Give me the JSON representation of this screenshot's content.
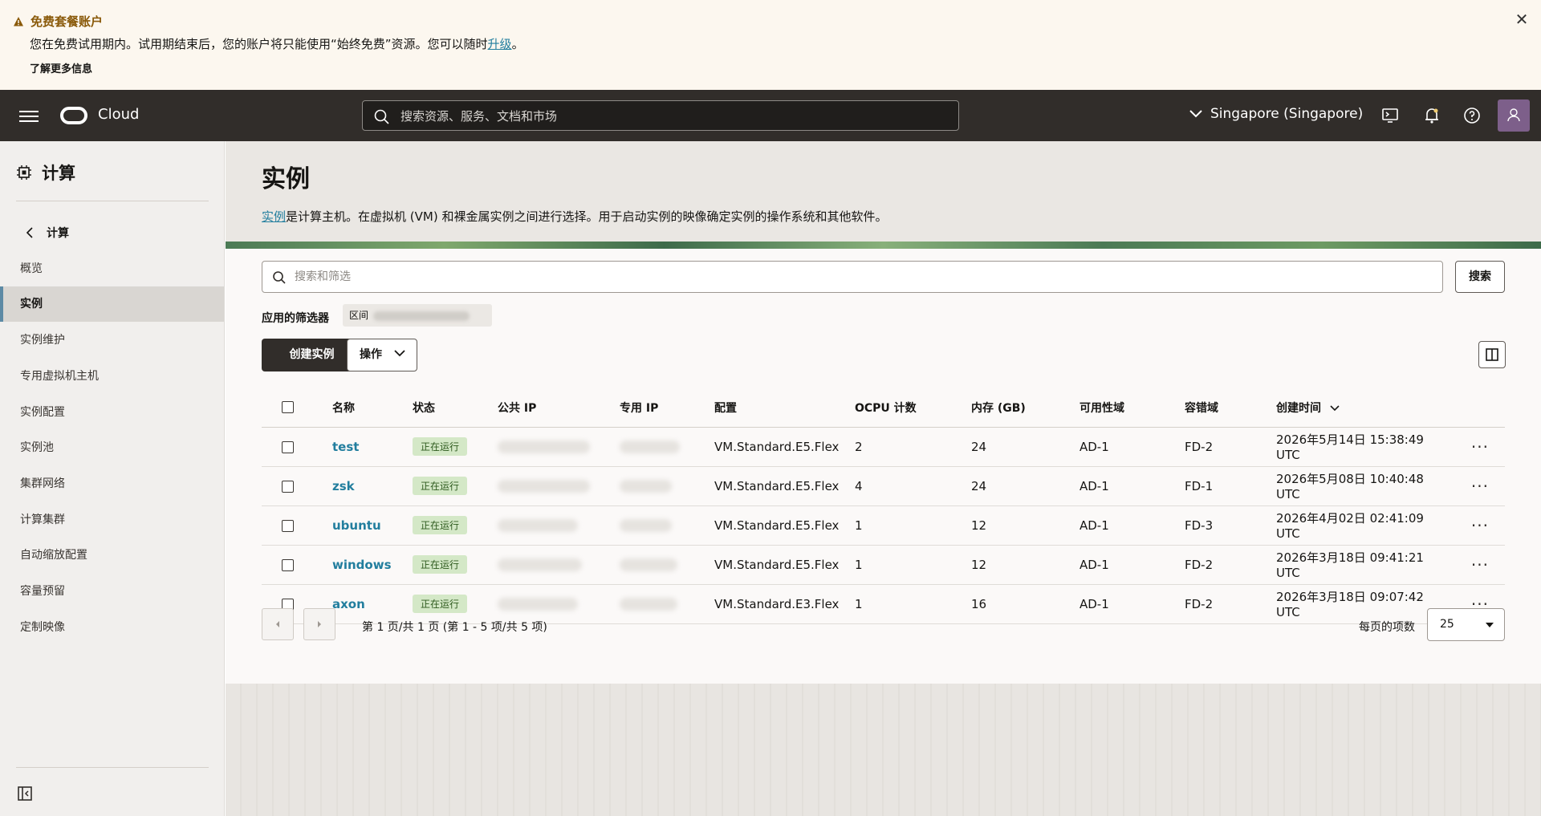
{
  "banner": {
    "title": "免费套餐账户",
    "text_before": "您在免费试用期内。试用期结束后，您的账户将只能使用“始终免费”资源。您可以随时",
    "upgrade_link": "升级",
    "text_after": "。",
    "learn_more": "了解更多信息"
  },
  "header": {
    "brand": "Cloud",
    "search_placeholder": "搜索资源、服务、文档和市场",
    "region": "Singapore (Singapore)"
  },
  "sidebar": {
    "title": "计算",
    "back_label": "计算",
    "items": [
      {
        "label": "概览"
      },
      {
        "label": "实例"
      },
      {
        "label": "实例维护"
      },
      {
        "label": "专用虚拟机主机"
      },
      {
        "label": "实例配置"
      },
      {
        "label": "实例池"
      },
      {
        "label": "集群网络"
      },
      {
        "label": "计算集群"
      },
      {
        "label": "自动缩放配置"
      },
      {
        "label": "容量预留"
      },
      {
        "label": "定制映像"
      }
    ],
    "active_index": 1
  },
  "main": {
    "title": "实例",
    "desc_link": "实例",
    "desc_text": "是计算主机。在虚拟机 (VM) 和裸金属实例之间进行选择。用于启动实例的映像确定实例的操作系统和其他软件。",
    "filter_placeholder": "搜索和筛选",
    "search_button": "搜索",
    "applied_filters_label": "应用的筛选器",
    "filter_chip_label": "区间",
    "create_button": "创建实例",
    "actions_button": "操作"
  },
  "table": {
    "columns": [
      "名称",
      "状态",
      "公共 IP",
      "专用 IP",
      "配置",
      "OCPU 计数",
      "内存 (GB)",
      "可用性域",
      "容错域",
      "创建时间"
    ],
    "rows": [
      {
        "name": "test",
        "status": "正在运行",
        "shape": "VM.Standard.E5.Flex",
        "ocpu": "2",
        "memory": "24",
        "ad": "AD-1",
        "fd": "FD-2",
        "created": "2026年5月14日 15:38:49 UTC"
      },
      {
        "name": "zsk",
        "status": "正在运行",
        "shape": "VM.Standard.E5.Flex",
        "ocpu": "4",
        "memory": "24",
        "ad": "AD-1",
        "fd": "FD-1",
        "created": "2026年5月08日 10:40:48 UTC"
      },
      {
        "name": "ubuntu",
        "status": "正在运行",
        "shape": "VM.Standard.E5.Flex",
        "ocpu": "1",
        "memory": "12",
        "ad": "AD-1",
        "fd": "FD-3",
        "created": "2026年4月02日 02:41:09 UTC"
      },
      {
        "name": "windows",
        "status": "正在运行",
        "shape": "VM.Standard.E5.Flex",
        "ocpu": "1",
        "memory": "12",
        "ad": "AD-1",
        "fd": "FD-2",
        "created": "2026年3月18日 09:41:21 UTC"
      },
      {
        "name": "axon",
        "status": "正在运行",
        "shape": "VM.Standard.E3.Flex",
        "ocpu": "1",
        "memory": "16",
        "ad": "AD-1",
        "fd": "FD-2",
        "created": "2026年3月18日 09:07:42 UTC"
      }
    ]
  },
  "pagination": {
    "page_text": "第 1 页/共 1 页 (第 1 - 5 项/共 5 项)",
    "per_page_label": "每页的项数",
    "per_page_value": "25"
  },
  "colors": {
    "header_bg": "#312d2a",
    "link": "#227e9e",
    "status_running_bg": "#d4e8c7",
    "banner_bg": "#fcf7ef"
  }
}
